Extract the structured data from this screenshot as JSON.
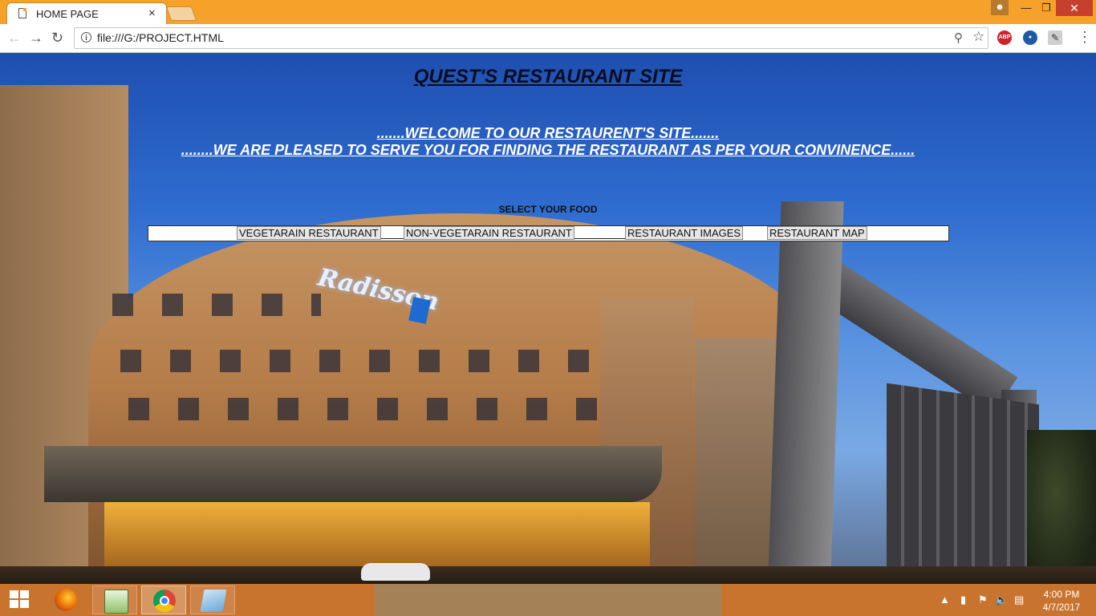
{
  "browser": {
    "tab_title": "HOME PAGE",
    "tab_close": "×",
    "url": "file:///G:/PROJECT.HTML",
    "extensions": [
      "ABP"
    ]
  },
  "page": {
    "title": "QUEST'S RESTAURANT SITE",
    "welcome_line1": ".......WELCOME TO OUR RESTAURENT'S SITE.......",
    "welcome_line2": "........WE ARE PLEASED TO SERVE YOU FOR FINDING THE RESTAURANT AS PER YOUR CONVINENCE......",
    "hotel_sign": "Radisson",
    "select_label": "SELECT YOUR FOOD",
    "nav_buttons": [
      "VEGETARAIN RESTAURANT",
      "NON-VEGETARAIN RESTAURANT",
      "RESTAURANT IMAGES",
      "RESTAURANT MAP"
    ]
  },
  "taskbar": {
    "time": "4:00 PM",
    "date": "4/7/2017",
    "apps": [
      "firefox",
      "notepad-plus",
      "chrome",
      "paint"
    ]
  },
  "colors": {
    "titlebar": "#f6a12a",
    "taskbar": "#c8742f",
    "close_button": "#c7402d"
  }
}
